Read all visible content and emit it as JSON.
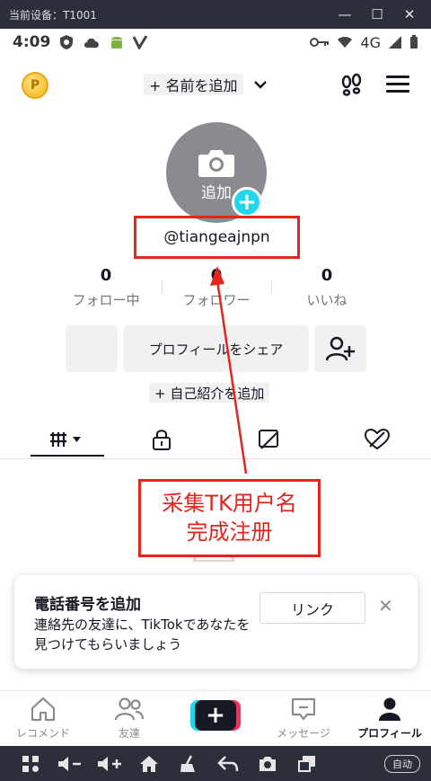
{
  "emulator": {
    "title": "当前设备：T1001",
    "minimize": "—",
    "maximize": "☐",
    "close": "✕",
    "auto_label": "自动"
  },
  "statusbar": {
    "time": "4:09",
    "network": "4G"
  },
  "topbar": {
    "coin_glyph": "P",
    "add_name_label": "+ 名前を追加",
    "chevron": "⌄"
  },
  "profile": {
    "avatar_add_label": "追加",
    "avatar_plus": "+",
    "username": "@tiangeajnpn",
    "stats": [
      {
        "value": "0",
        "label": "フォロー中"
      },
      {
        "value": "0",
        "label": "フォロワー"
      },
      {
        "value": "0",
        "label": "いいね"
      }
    ],
    "share_button": "プロフィールをシェア",
    "add_bio_label": "+ 自己紹介を追加"
  },
  "annotation": {
    "line1": "采集TK用户名",
    "line2": "完成注册",
    "color": "#e8231b"
  },
  "phone_card": {
    "title": "電話番号を追加",
    "body": "連絡先の友達に、TikTokであなたを見つけてもらいましょう",
    "link_button": "リンク",
    "close": "✕"
  },
  "bottom_nav": {
    "items": [
      {
        "label": "レコメンド",
        "icon": "home-icon"
      },
      {
        "label": "友達",
        "icon": "friends-icon"
      },
      {
        "label": "",
        "icon": "create-plus-icon"
      },
      {
        "label": "メッセージ",
        "icon": "message-icon"
      },
      {
        "label": "プロフィール",
        "icon": "profile-icon",
        "active": true
      }
    ],
    "create_glyph": "+"
  },
  "colors": {
    "accent_cyan": "#20d5ec",
    "accent_red": "#fe2c55",
    "text": "#161823"
  }
}
